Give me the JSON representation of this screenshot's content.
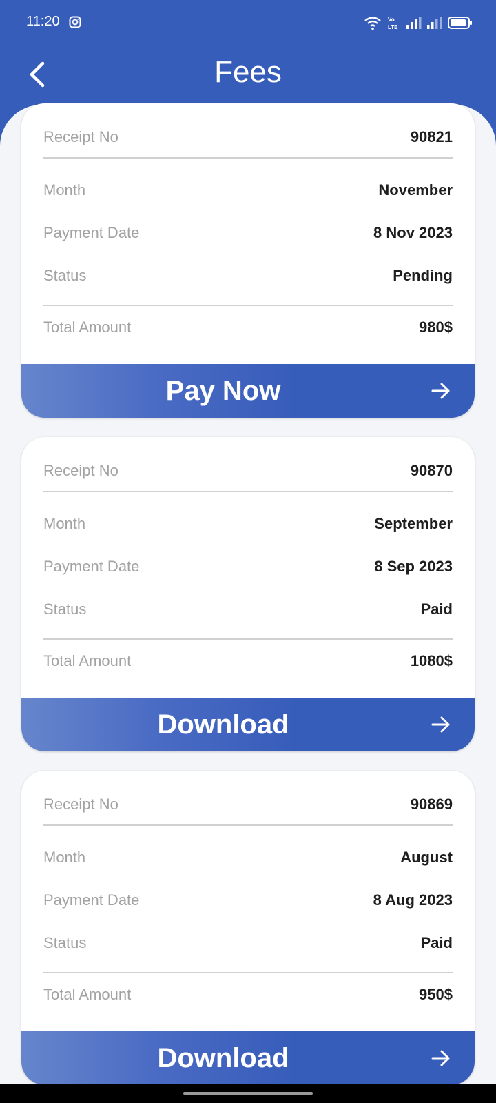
{
  "status_bar": {
    "time": "11:20"
  },
  "header": {
    "title": "Fees"
  },
  "labels": {
    "receipt": "Receipt No",
    "month": "Month",
    "payment_date": "Payment Date",
    "status": "Status",
    "total": "Total Amount"
  },
  "cards": [
    {
      "receipt_no": "90821",
      "month": "November",
      "payment_date": "8 Nov 2023",
      "status": "Pending",
      "total": "980$",
      "action": "Pay Now"
    },
    {
      "receipt_no": "90870",
      "month": "September",
      "payment_date": "8 Sep 2023",
      "status": "Paid",
      "total": "1080$",
      "action": "Download"
    },
    {
      "receipt_no": "90869",
      "month": "August",
      "payment_date": "8 Aug 2023",
      "status": "Paid",
      "total": "950$",
      "action": "Download"
    }
  ],
  "colors": {
    "primary": "#375dba",
    "background": "#f3f5f8",
    "label_gray": "#a2a2a2",
    "value_dark": "#1e1e1e"
  }
}
